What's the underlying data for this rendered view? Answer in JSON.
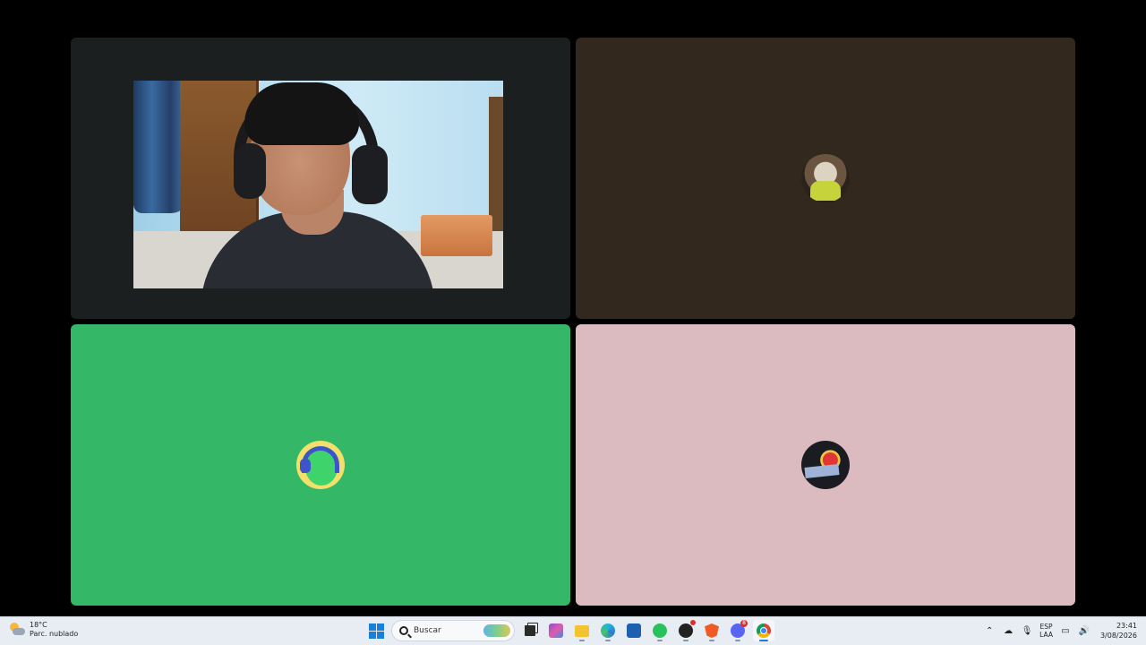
{
  "tiles": [
    {
      "id": "participant-1",
      "type": "camera",
      "background": "#1c1f20"
    },
    {
      "id": "participant-2",
      "type": "avatar",
      "background": "#33281d"
    },
    {
      "id": "participant-3",
      "type": "avatar",
      "background": "#35b768"
    },
    {
      "id": "participant-4",
      "type": "avatar",
      "background": "#dbbac0"
    }
  ],
  "taskbar": {
    "weather": {
      "temp": "18°C",
      "desc": "Parc. nublado"
    },
    "search_placeholder": "Buscar",
    "apps": [
      "start-icon",
      "search-icon",
      "task-view-icon",
      "widgets-icon",
      "file-explorer-icon",
      "edge-icon",
      "store-icon",
      "whatsapp-icon",
      "github-icon",
      "brave-icon",
      "discord-icon",
      "chrome-icon"
    ],
    "badges": {
      "github": "",
      "discord": "8"
    },
    "tray": {
      "lang_top": "ESP",
      "lang_bottom": "LAA",
      "time": "23:41",
      "date": "3/08/2026"
    }
  }
}
